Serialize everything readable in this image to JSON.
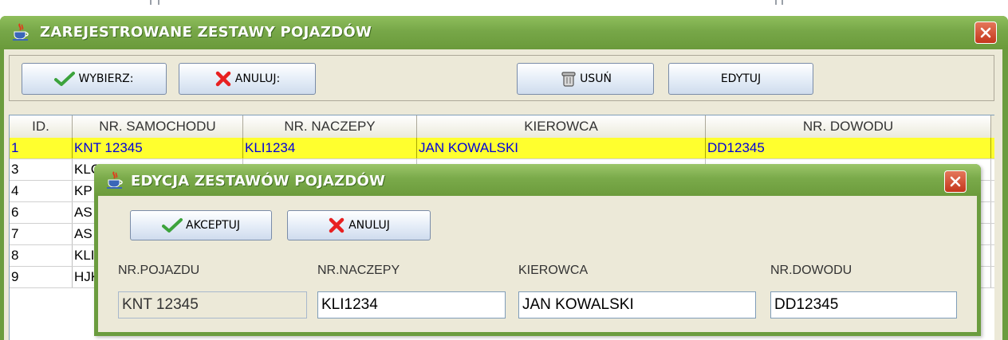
{
  "main_window": {
    "title": "ZAREJESTROWANE ZESTAWY POJAZDÓW",
    "toolbar": {
      "select_label": "WYBIERZ:",
      "cancel_label": "ANULUJ:",
      "delete_label": "USUŃ",
      "edit_label": "EDYTUJ"
    },
    "table": {
      "columns": [
        "ID.",
        "NR. SAMOCHODU",
        "NR. NACZEPY",
        "KIEROWCA",
        "NR. DOWODU"
      ],
      "rows": [
        [
          "1",
          "KNT 12345",
          "KLI1234",
          "JAN KOWALSKI",
          "DD12345"
        ],
        [
          "3",
          "KLC",
          "",
          "",
          ""
        ],
        [
          "4",
          "KP",
          "",
          "",
          ""
        ],
        [
          "6",
          "AS",
          "",
          "",
          ""
        ],
        [
          "7",
          "AS",
          "",
          "",
          ""
        ],
        [
          "8",
          "KLI",
          "",
          "",
          ""
        ],
        [
          "9",
          "HJK",
          "",
          "",
          ""
        ]
      ]
    }
  },
  "dialog": {
    "title": "EDYCJA ZESTAWÓW POJAZDÓW",
    "accept_label": "AKCEPTUJ",
    "cancel_label": "ANULUJ",
    "fields": {
      "vehicle": {
        "label": "NR.POJAZDU",
        "value": "KNT 12345"
      },
      "trailer": {
        "label": "NR.NACZEPY",
        "value": "KLI1234"
      },
      "driver": {
        "label": "KIEROWCA",
        "value": "JAN KOWALSKI"
      },
      "document": {
        "label": "NR.DOWODU",
        "value": "DD12345"
      }
    }
  },
  "colors": {
    "title_green": "#6b9c3e",
    "selected_row": "#ffff2e",
    "selected_text": "#0000dd",
    "close_red": "#c4361c"
  },
  "icons": [
    "java-cup-icon",
    "close-icon",
    "checkmark-icon",
    "cross-icon",
    "trash-bin-icon"
  ]
}
